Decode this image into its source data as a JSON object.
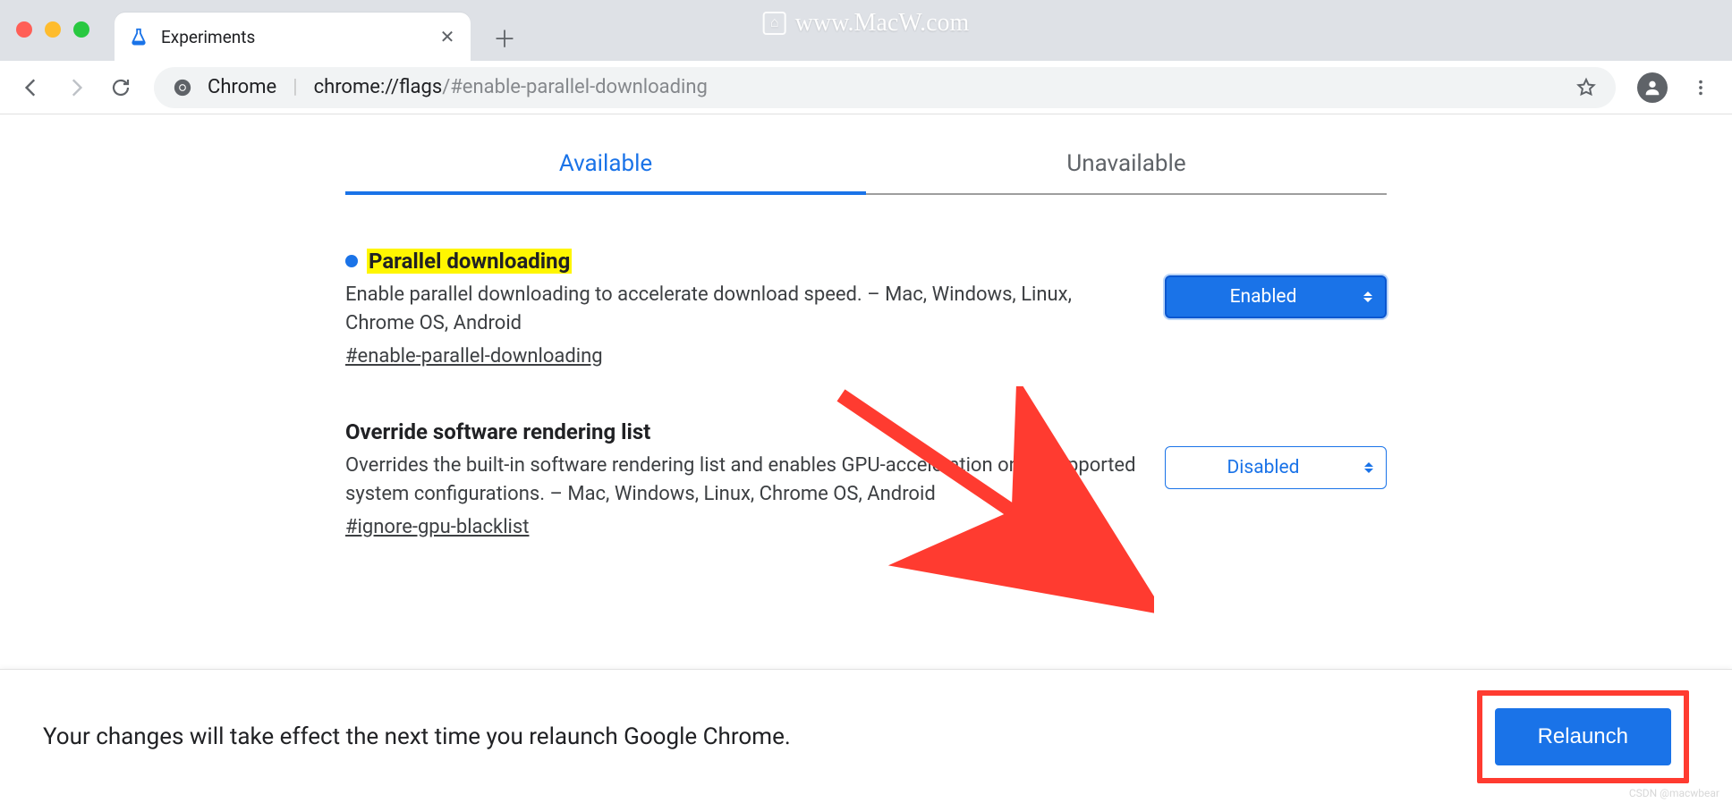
{
  "window": {
    "watermark": "www.MacW.com",
    "credit": "CSDN @macwbear"
  },
  "tab": {
    "title": "Experiments"
  },
  "omnibox": {
    "scheme_label": "Chrome",
    "url_bold": "chrome://flags",
    "url_path": "/#enable-parallel-downloading"
  },
  "content_tabs": {
    "available": "Available",
    "unavailable": "Unavailable"
  },
  "flags": [
    {
      "title": "Parallel downloading",
      "highlighted": true,
      "modified": true,
      "description": "Enable parallel downloading to accelerate download speed. – Mac, Windows, Linux, Chrome OS, Android",
      "hash": "#enable-parallel-downloading",
      "value": "Enabled",
      "style": "filled"
    },
    {
      "title": "Override software rendering list",
      "highlighted": false,
      "modified": false,
      "description": "Overrides the built-in software rendering list and enables GPU-acceleration on unsupported system configurations. – Mac, Windows, Linux, Chrome OS, Android",
      "hash": "#ignore-gpu-blacklist",
      "value": "Disabled",
      "style": "outline"
    }
  ],
  "bottom": {
    "message": "Your changes will take effect the next time you relaunch Google Chrome.",
    "relaunch": "Relaunch"
  }
}
